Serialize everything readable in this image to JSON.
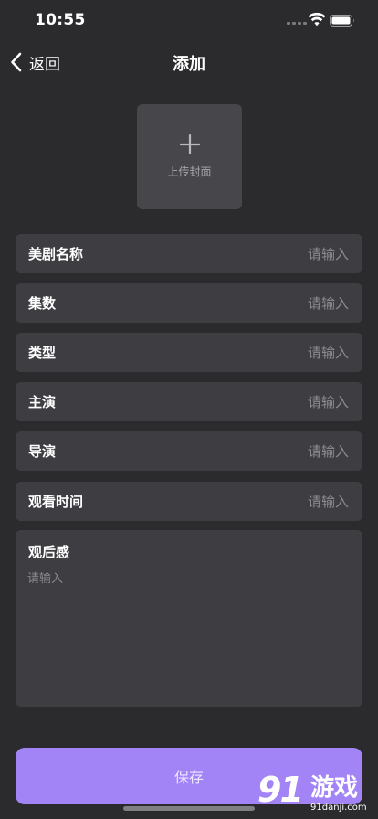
{
  "status_bar": {
    "time": "10:55"
  },
  "nav": {
    "back_label": "返回",
    "title": "添加"
  },
  "cover": {
    "label": "上传封面"
  },
  "form": {
    "fields": [
      {
        "label": "美剧名称",
        "placeholder": "请输入",
        "value": ""
      },
      {
        "label": "集数",
        "placeholder": "请输入",
        "value": ""
      },
      {
        "label": "类型",
        "placeholder": "请输入",
        "value": ""
      },
      {
        "label": "主演",
        "placeholder": "请输入",
        "value": ""
      },
      {
        "label": "导演",
        "placeholder": "请输入",
        "value": ""
      },
      {
        "label": "观看时间",
        "placeholder": "请输入",
        "value": ""
      }
    ],
    "review": {
      "label": "观后感",
      "placeholder": "请输入",
      "value": ""
    }
  },
  "save_button": {
    "label": "保存"
  },
  "watermark": {
    "logo": "91",
    "text": "游戏",
    "url": "91danji.com"
  },
  "colors": {
    "background": "#2b2b2e",
    "field_background": "#3e3d42",
    "accent": "#a284f7",
    "placeholder": "#8c8c90"
  },
  "icons": {
    "back": "chevron-left-icon",
    "upload": "plus-icon",
    "wifi": "wifi-icon",
    "battery": "battery-icon",
    "signal": "cellular-signal-icon"
  }
}
